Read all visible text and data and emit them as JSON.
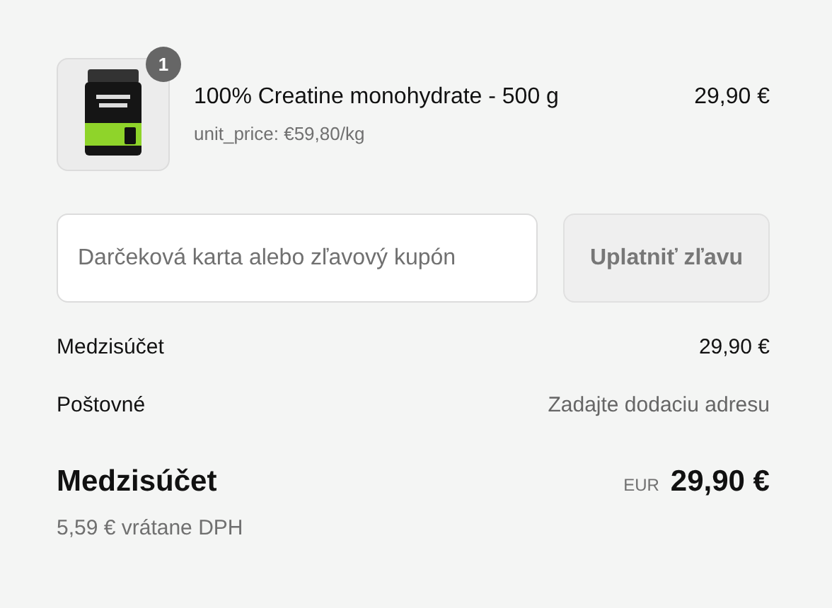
{
  "line_items": [
    {
      "quantity": "1",
      "title": "100% Creatine monohydrate - 500 g",
      "unit_price": "unit_price: €59,80/kg",
      "price": "29,90 €"
    }
  ],
  "discount": {
    "placeholder": "Darčeková karta alebo zľavový kupón",
    "button": "Uplatniť zľavu"
  },
  "summary_rows": [
    {
      "label": "Medzisúčet",
      "value": "29,90 €",
      "kind": "amount"
    },
    {
      "label": "Poštovné",
      "value": "Zadajte dodaciu adresu",
      "kind": "note"
    }
  ],
  "total": {
    "label": "Medzisúčet",
    "currency": "EUR",
    "amount": "29,90 €",
    "tax_note": "5,59 € vrátane DPH"
  }
}
